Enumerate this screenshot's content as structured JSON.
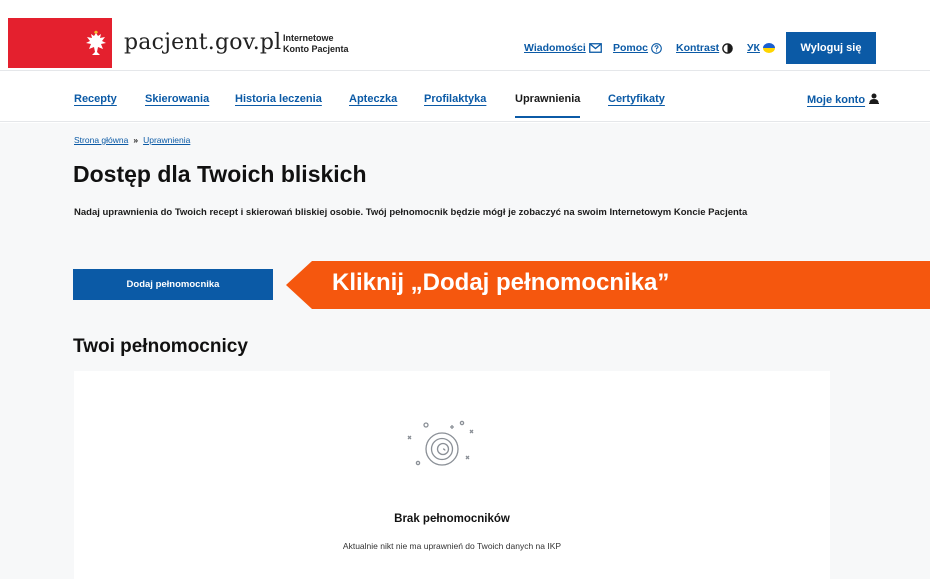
{
  "header": {
    "site_name": "pacjent.gov.pl",
    "site_sub_line1": "Internetowe",
    "site_sub_line2": "Konto Pacjenta",
    "links": {
      "messages": "Wiadomości",
      "help": "Pomoc",
      "contrast": "Kontrast",
      "language": "УК"
    },
    "logout": "Wyloguj się"
  },
  "nav": {
    "items": [
      "Recepty",
      "Skierowania",
      "Historia leczenia",
      "Apteczka",
      "Profilaktyka",
      "Uprawnienia",
      "Certyfikaty"
    ],
    "active_index": 5,
    "account": "Moje konto"
  },
  "breadcrumb": {
    "home": "Strona główna",
    "separator": "»",
    "current": "Uprawnienia"
  },
  "page": {
    "title": "Dostęp dla Twoich bliskich",
    "description": "Nadaj uprawnienia do Twoich recept i skierowań bliskiej osobie. Twój pełnomocnik będzie mógł je zobaczyć na swoim Internetowym Koncie Pacjenta",
    "add_button": "Dodaj pełnomocnika",
    "callout": "Kliknij „Dodaj pełnomocnika”",
    "section_title": "Twoi pełnomocnicy"
  },
  "empty_state": {
    "title": "Brak pełnomocników",
    "description": "Aktualnie nikt nie ma uprawnień do Twoich danych na IKP"
  },
  "colors": {
    "primary": "#0b5aa6",
    "emblem_red": "#e4202e",
    "callout_orange": "#f5570e",
    "page_bg": "#f7f8f9"
  },
  "icons": {
    "emblem": "polish-eagle-emblem-icon",
    "messages": "envelope-icon",
    "help": "question-circle-icon",
    "contrast": "half-circle-contrast-icon",
    "language": "ukraine-flag-icon",
    "account": "user-icon",
    "empty": "spiral-empty-icon"
  }
}
